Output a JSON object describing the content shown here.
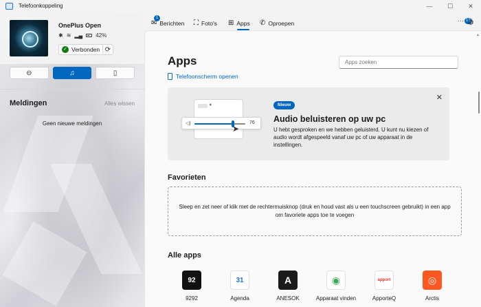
{
  "window": {
    "title": "Telefoonkoppeling",
    "minimize": "—",
    "maximize": "☐",
    "close": "✕"
  },
  "device": {
    "name": "OnePlus Open",
    "battery": "42%",
    "status": "Verbonden",
    "bluetooth_icon": "bluetooth-icon",
    "wifi_icon": "wifi-icon",
    "signal_icon": "signal-icon"
  },
  "modes": [
    {
      "icon": "⊖",
      "name": "dnd-icon"
    },
    {
      "icon": "♫",
      "name": "music-icon"
    },
    {
      "icon": "▯",
      "name": "phone-audio-icon"
    }
  ],
  "notifications": {
    "title": "Meldingen",
    "clear_all": "Alles wissen",
    "empty": "Geen nieuwe meldingen"
  },
  "tabs": [
    {
      "label": "Berichten",
      "badge": "1",
      "icon": "✉"
    },
    {
      "label": "Foto's",
      "icon": "⛶"
    },
    {
      "label": "Apps",
      "icon": "⊞",
      "active": true
    },
    {
      "label": "Oproepen",
      "icon": "✆"
    }
  ],
  "header_right": {
    "more": "···",
    "badge": "13",
    "settings": "⚙"
  },
  "main": {
    "title": "Apps",
    "search_placeholder": "Apps zoeken",
    "open_screen": "Telefoonscherm openen"
  },
  "promo": {
    "badge": "Nieuw",
    "title": "Audio beluisteren op uw pc",
    "description": "U hebt gesproken en we hebben geluisterd. U kunt nu kiezen of audio wordt afgespeeld vanaf uw pc of uw apparaat in de instellingen.",
    "volume_value": "76",
    "volume_level": 0.76,
    "close": "✕"
  },
  "favorites": {
    "title": "Favorieten",
    "hint": "Sleep en zet neer of klik met de rechtermuisknop (druk en houd vast als u een touchscreen gebruikt) in een app om favoriete apps toe te voegen"
  },
  "all_apps": {
    "title": "Alle apps",
    "items": [
      {
        "label": "9292",
        "glyph": "92",
        "bg": "#111111",
        "fg": "#ffffff"
      },
      {
        "label": "Agenda",
        "glyph": "31",
        "bg": "#ffffff",
        "fg": "#1a73e8"
      },
      {
        "label": "ANESOK",
        "glyph": "A",
        "bg": "#1b1b1b",
        "fg": "#ffffff"
      },
      {
        "label": "Apparaat vinden",
        "glyph": "◉",
        "bg": "#ffffff",
        "fg": "#34a853"
      },
      {
        "label": "ApporteQ",
        "glyph": "apport",
        "bg": "#ffffff",
        "fg": "#e63329"
      },
      {
        "label": "Arctis",
        "glyph": "◎",
        "bg": "#ff5722",
        "fg": "#ffffff"
      }
    ]
  }
}
